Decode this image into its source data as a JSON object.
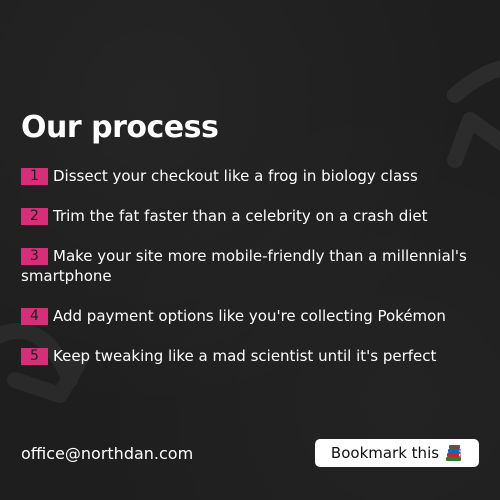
{
  "heading": "Our process",
  "steps": [
    {
      "number": "1",
      "text": "Dissect your checkout like a frog in biology class"
    },
    {
      "number": "2",
      "text": "Trim the fat faster than a celebrity on a crash diet"
    },
    {
      "number": "3",
      "text": "Make your site more mobile-friendly than a millennial's smartphone"
    },
    {
      "number": "4",
      "text": "Add payment options like you're collecting Pokémon"
    },
    {
      "number": "5",
      "text": "Keep tweaking like a mad scientist until it's perfect"
    }
  ],
  "footer": {
    "email": "office@northdan.com",
    "bookmark_label": "Bookmark this",
    "bookmark_icon": "books-icon"
  },
  "colors": {
    "background": "#1e1e1e",
    "accent": "#d62f7a",
    "text": "#ffffff",
    "button_bg": "#ffffff"
  }
}
